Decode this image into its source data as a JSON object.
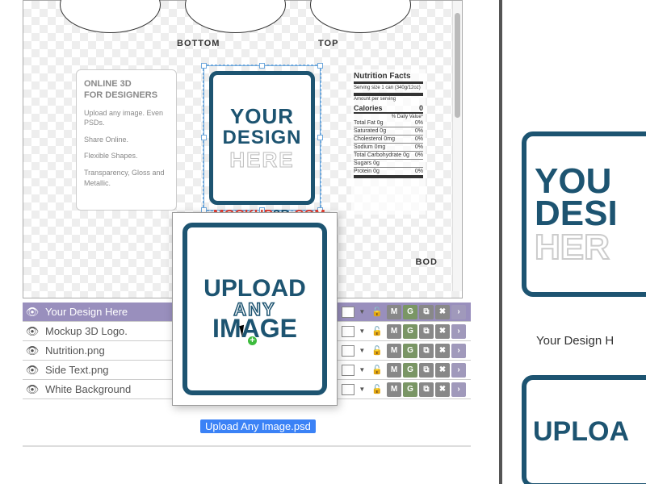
{
  "canvas": {
    "labels": {
      "bottom": "BOTTOM",
      "top": "TOP",
      "body": "BOD"
    },
    "info": {
      "title1": "ONLINE 3D",
      "title2": "FOR DESIGNERS",
      "line1": "Upload any image. Even PSDs.",
      "line2": "Share Online.",
      "line3": "Flexible Shapes.",
      "line4": "Transparency, Gloss and Metallic."
    },
    "design": {
      "l1": "YOUR",
      "l2": "DESIGN",
      "l3": "HERE"
    },
    "logo": {
      "a": "MOCKUP",
      "b": "3D",
      "c": ".COM"
    },
    "nutrition": {
      "title": "Nutrition Facts",
      "serving": "Serving size 1 can (340g/12oz)",
      "amount": "Amount per serving",
      "calories_label": "Calories",
      "calories": "0",
      "dv": "% Daily Value*",
      "rows": [
        {
          "n": "Total Fat 0g",
          "v": "0%"
        },
        {
          "n": "Saturated 0g",
          "v": "0%"
        },
        {
          "n": "Cholesterol 0mg",
          "v": "0%"
        },
        {
          "n": "Sodium 0mg",
          "v": "0%"
        },
        {
          "n": "Total Carbohydrate 0g",
          "v": "0%"
        },
        {
          "n": "Sugars 0g",
          "v": ""
        },
        {
          "n": "Protein 0g",
          "v": "0%"
        }
      ]
    }
  },
  "layers": [
    {
      "name": "Your Design Here",
      "sel": true
    },
    {
      "name": "Mockup 3D Logo.",
      "sel": false
    },
    {
      "name": "Nutrition.png",
      "sel": false
    },
    {
      "name": "Side Text.png",
      "sel": false
    },
    {
      "name": "White Background",
      "sel": false
    }
  ],
  "drag": {
    "l1": "UPLOAD",
    "l2": "ANY",
    "l3": "IMAGE",
    "filename": "Upload Any Image.psd"
  },
  "right": {
    "tile": {
      "l1": "YOU",
      "l2": "DESI",
      "l3": "HER"
    },
    "caption": "Your Design H",
    "tile2": "UPLOA"
  }
}
